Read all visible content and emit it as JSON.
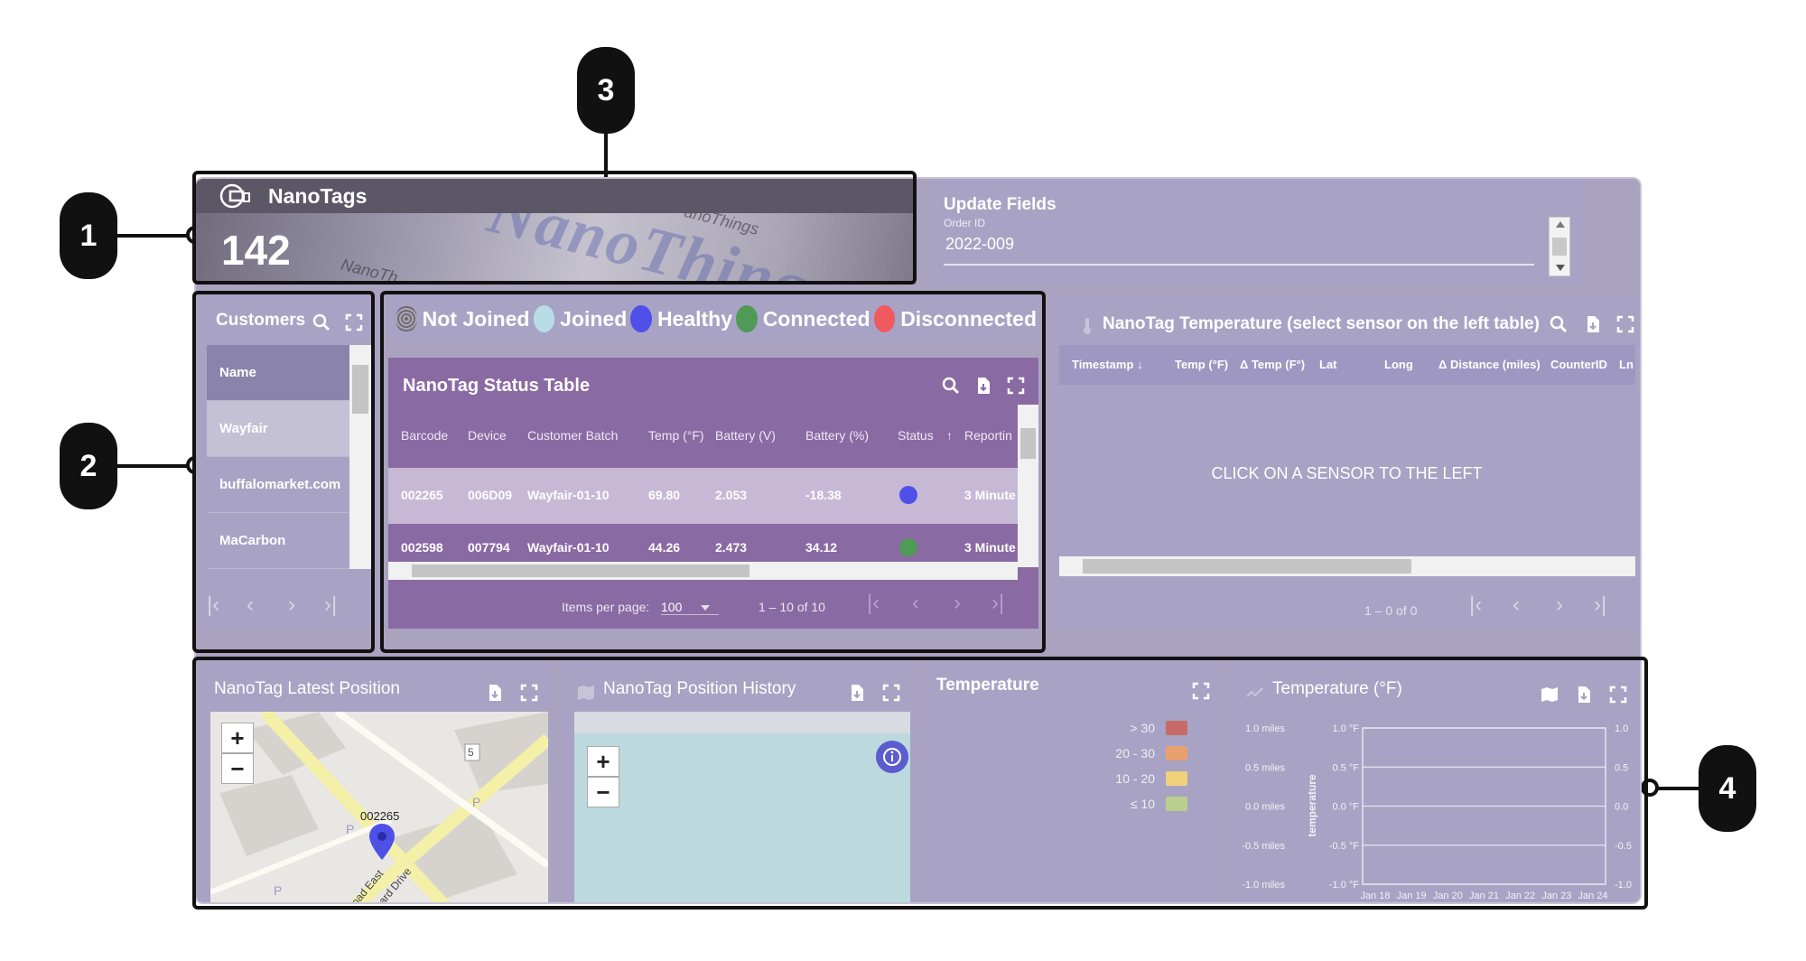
{
  "callouts": [
    "1",
    "2",
    "3",
    "4"
  ],
  "nanotags": {
    "title": "NanoTags",
    "count": "142",
    "watermark": "NanoThings",
    "watermark_small": "anoThings",
    "watermark_corner": "NanoTh"
  },
  "update_fields": {
    "title": "Update Fields",
    "field_label": "Order ID",
    "field_value": "2022-009"
  },
  "customers": {
    "title": "Customers",
    "column": "Name",
    "rows": [
      "Wayfair",
      "buffalomarket.com",
      "MaCarbon"
    ]
  },
  "legend": [
    {
      "label": "Not Joined",
      "color": "#8f8a96"
    },
    {
      "label": "Joined",
      "color": "#b9dde6"
    },
    {
      "label": "Healthy",
      "color": "#4f50e8"
    },
    {
      "label": "Connected",
      "color": "#4f9a57"
    },
    {
      "label": "Disconnected",
      "color": "#f05a5f"
    }
  ],
  "status_table": {
    "title": "NanoTag Status Table",
    "columns": [
      "Barcode",
      "Device",
      "Customer Batch",
      "Temp (°F)",
      "Battery (V)",
      "Battery (%)",
      "Status",
      "Reportin"
    ],
    "rows": [
      {
        "barcode": "002265",
        "device": "006D09",
        "batch": "Wayfair-01-10",
        "temp": "69.80",
        "batt_v": "2.053",
        "batt_p": "-18.38",
        "status_color": "#4f50e8",
        "reporting": "3 Minute"
      },
      {
        "barcode": "002598",
        "device": "007794",
        "batch": "Wayfair-01-10",
        "temp": "44.26",
        "batt_v": "2.473",
        "batt_p": "34.12",
        "status_color": "#4f9a57",
        "reporting": "3 Minute"
      }
    ],
    "items_per_page_label": "Items per page:",
    "items_per_page": "100",
    "range": "1 – 10 of 10"
  },
  "temp_table": {
    "title": "NanoTag Temperature (select sensor on the left table)",
    "columns": [
      "Timestamp ↓",
      "Temp (°F)",
      "Δ Temp (F°)",
      "Lat",
      "Long",
      "Δ Distance (miles)",
      "CounterID",
      "Ln"
    ],
    "message": "CLICK ON A SENSOR TO THE LEFT",
    "range": "1 – 0 of 0"
  },
  "latest_position": {
    "title": "NanoTag Latest Position",
    "marker_label": "002265",
    "zoom_in": "+",
    "zoom_out": "−",
    "road_badge": "5",
    "street_labels": [
      "oad East",
      "ard Drive"
    ],
    "parking": "P"
  },
  "position_history": {
    "title": "NanoTag Position History",
    "zoom_in": "+",
    "zoom_out": "−"
  },
  "temperature_legend": {
    "title": "Temperature",
    "items": [
      {
        "label": "> 30",
        "color": "#c96a6a"
      },
      {
        "label": "20 - 30",
        "color": "#e8a070"
      },
      {
        "label": "10 - 20",
        "color": "#efd27a"
      },
      {
        "label": "≤ 10",
        "color": "#b8cf8e"
      }
    ]
  },
  "chart_data": {
    "type": "line",
    "title": "Temperature (°F)",
    "ylabel": "temperature",
    "categories": [
      "Jan 18",
      "Jan 19",
      "Jan 20",
      "Jan 21",
      "Jan 22",
      "Jan 23",
      "Jan 24"
    ],
    "left_axis_ticks": [
      "1.0 miles",
      "0.5 miles",
      "0.0 miles",
      "-0.5 miles",
      "-1.0 miles"
    ],
    "mid_axis_ticks": [
      "1.0 °F",
      "0.5 °F",
      "0.0 °F",
      "-0.5 °F",
      "-1.0 °F"
    ],
    "right_axis_ticks": [
      "1.0",
      "0.5",
      "0.0",
      "-0.5",
      "-1.0"
    ],
    "ylim": [
      -1.0,
      1.0
    ],
    "series": [],
    "grid": true
  }
}
